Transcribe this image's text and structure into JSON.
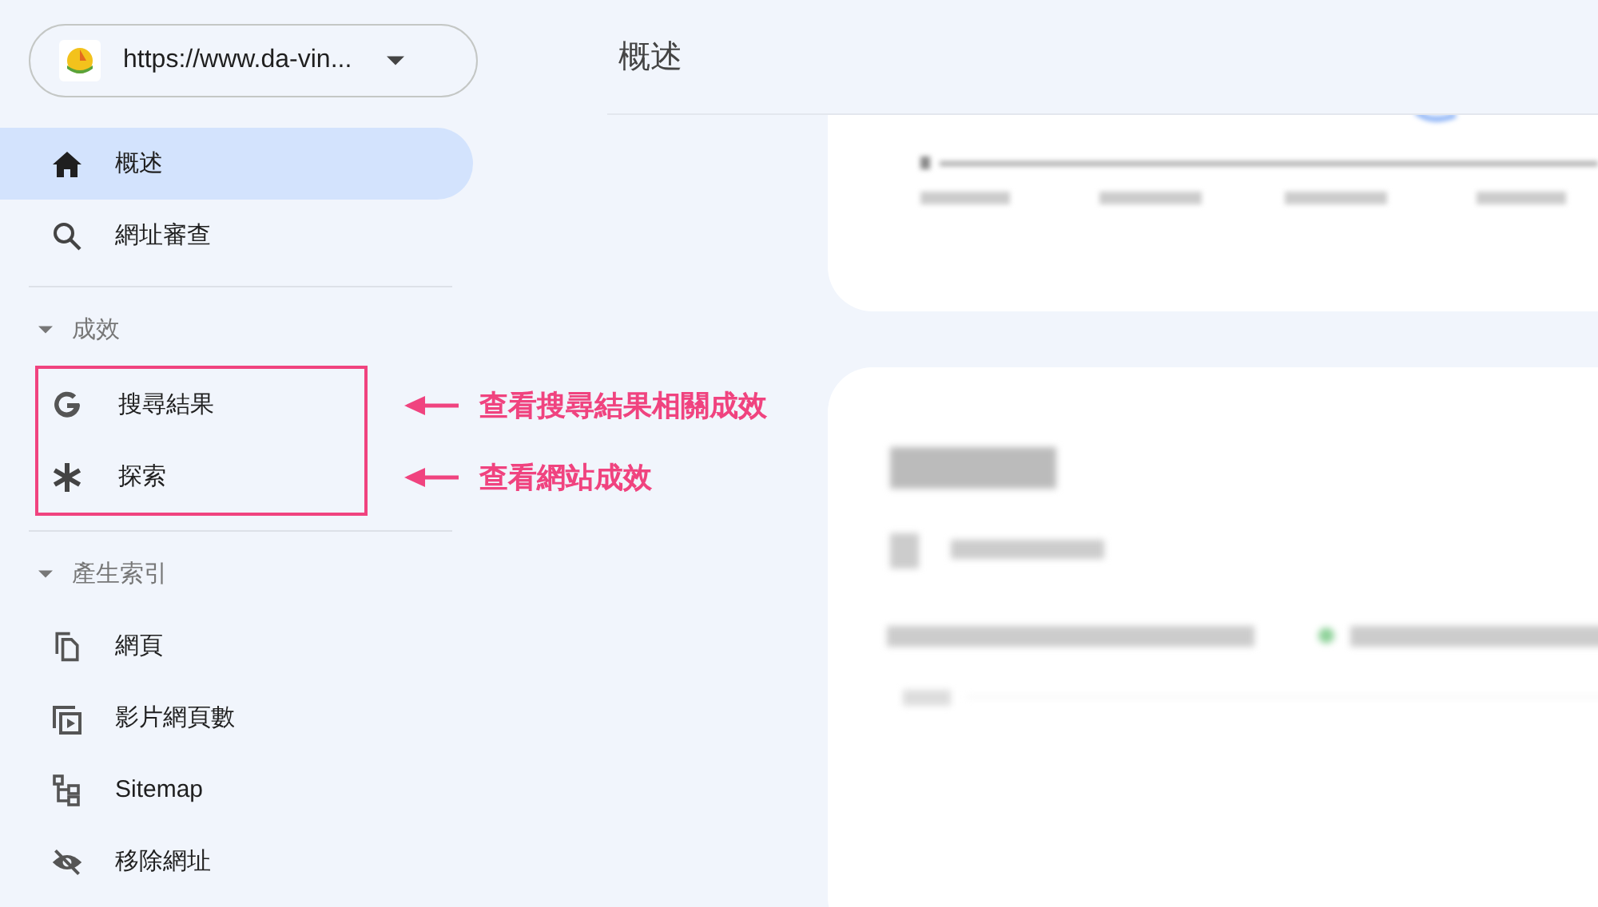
{
  "property_selector": {
    "value": "https://www.da-vin..."
  },
  "header": {
    "title": "概述"
  },
  "sidebar": {
    "items": [
      {
        "label": "概述",
        "selected": true
      },
      {
        "label": "網址審查",
        "selected": false
      }
    ],
    "sections": [
      {
        "title": "成效",
        "expanded": true,
        "highlighted": true,
        "children": [
          {
            "label": "搜尋結果",
            "selected": false,
            "note": "查看搜尋結果相關成效"
          },
          {
            "label": "探索",
            "selected": false,
            "note": "查看網站成效"
          }
        ]
      },
      {
        "title": "產生索引",
        "expanded": true,
        "highlighted": false,
        "children": [
          {
            "label": "網頁",
            "selected": false
          },
          {
            "label": "影片網頁數",
            "selected": false
          },
          {
            "label": "Sitemap",
            "selected": false
          },
          {
            "label": "移除網址",
            "selected": false
          }
        ]
      }
    ]
  }
}
